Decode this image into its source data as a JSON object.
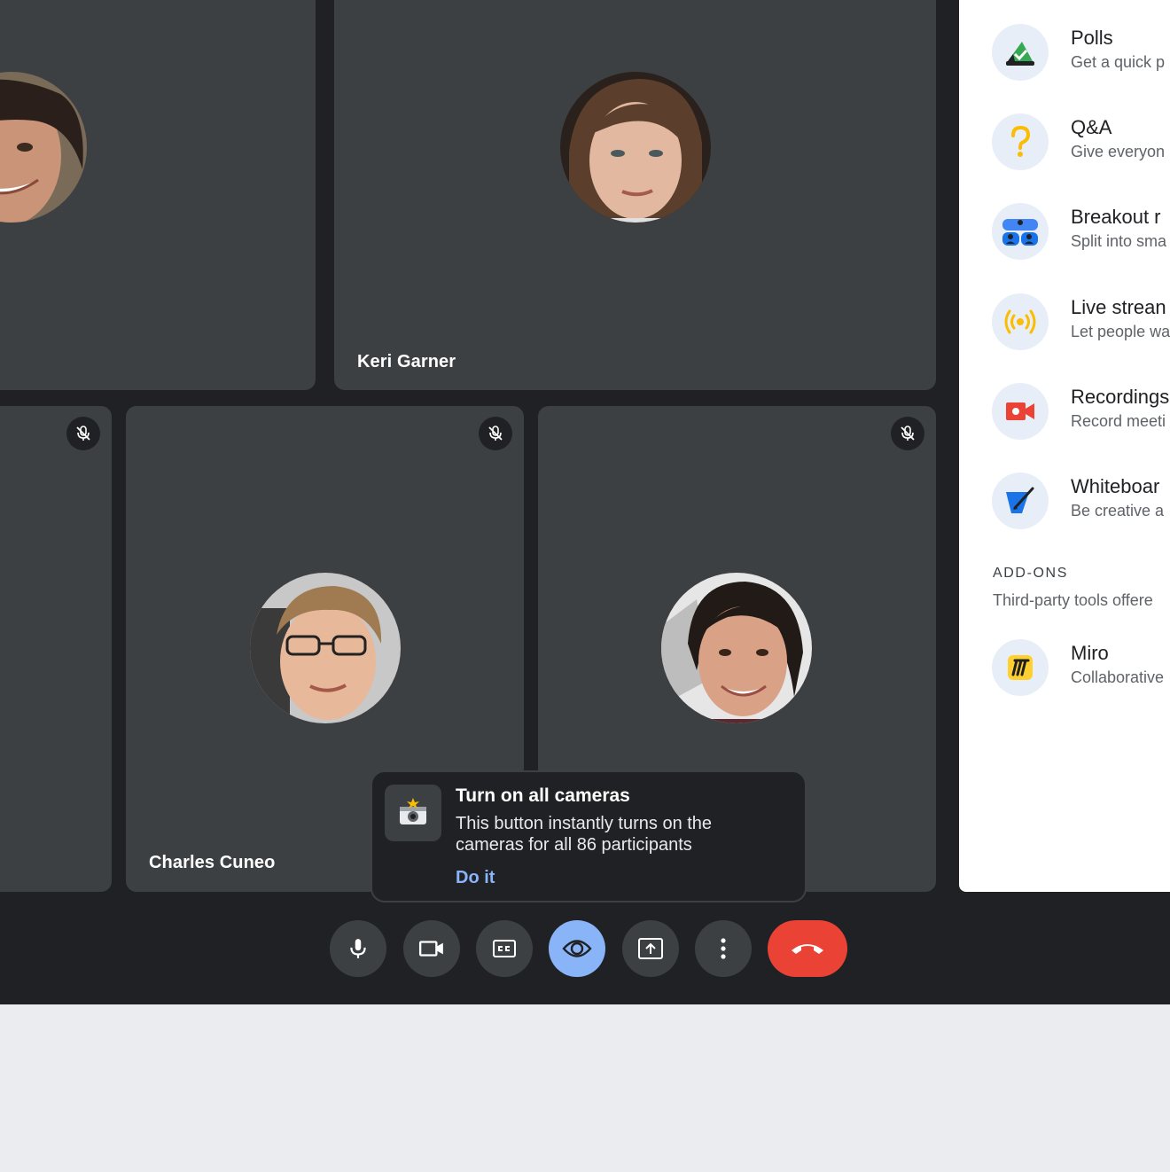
{
  "participants": [
    {
      "name": ""
    },
    {
      "name": "Keri Garner"
    },
    {
      "name": ""
    },
    {
      "name": "Charles Cuneo"
    },
    {
      "name": ""
    }
  ],
  "toast": {
    "title": "Turn on all cameras",
    "body": "This button instantly turns on the cameras for all 86 participants",
    "action": "Do it",
    "icon": "camera-flash-icon"
  },
  "activities": [
    {
      "title": "Polls",
      "subtitle": "Get a quick p",
      "icon": "polls-icon"
    },
    {
      "title": "Q&A",
      "subtitle": "Give everyon",
      "icon": "qa-icon"
    },
    {
      "title": "Breakout r",
      "subtitle": "Split into sma",
      "icon": "breakout-rooms-icon"
    },
    {
      "title": "Live strean",
      "subtitle": "Let people wa",
      "icon": "live-stream-icon"
    },
    {
      "title": "Recordings",
      "subtitle": "Record meeti",
      "icon": "recording-icon"
    },
    {
      "title": "Whiteboar",
      "subtitle": "Be creative a",
      "icon": "whiteboard-icon"
    }
  ],
  "addons": {
    "label": "ADD-ONS",
    "subtitle": "Third-party tools offere",
    "items": [
      {
        "title": "Miro",
        "subtitle": "Collaborative",
        "icon": "miro-icon"
      }
    ]
  },
  "controls": [
    "mic-icon",
    "camera-icon",
    "captions-icon",
    "eye-icon",
    "present-icon",
    "more-icon",
    "end-call-icon"
  ],
  "colors": {
    "background": "#202124",
    "tile": "#3c4043",
    "accent": "#8ab4f8",
    "end_call": "#ea4335",
    "panel": "#ffffff"
  }
}
